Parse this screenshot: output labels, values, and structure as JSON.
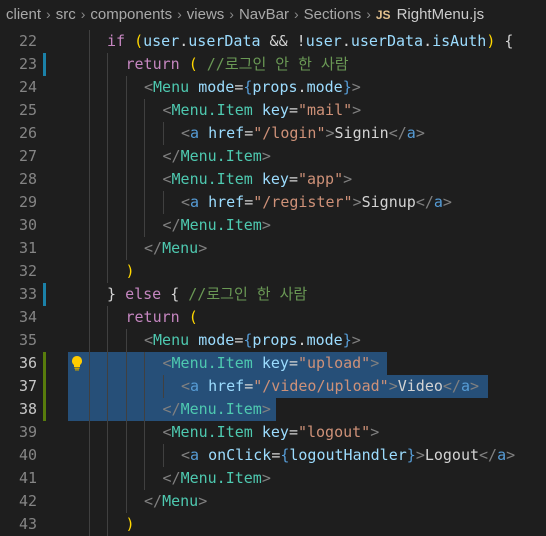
{
  "breadcrumb": {
    "items": [
      "client",
      "src",
      "components",
      "views",
      "NavBar",
      "Sections"
    ],
    "file_icon": "JS",
    "file_name": "RightMenu.js"
  },
  "editor": {
    "first_line_number": 22,
    "selected_lines": [
      36,
      37,
      38
    ],
    "active_lines": [
      36,
      37,
      38
    ],
    "lightbulb_line": 36,
    "change_markers": [
      {
        "line": 23,
        "kind": "modified"
      },
      {
        "line": 33,
        "kind": "modified"
      },
      {
        "line": 36,
        "kind": "added"
      },
      {
        "line": 37,
        "kind": "added"
      },
      {
        "line": 38,
        "kind": "added"
      }
    ],
    "lines": [
      {
        "n": 22,
        "indent": 2,
        "tokens": [
          [
            "kw",
            "if"
          ],
          [
            "p",
            " "
          ],
          [
            "y",
            "("
          ],
          [
            "v",
            "user"
          ],
          [
            "p",
            "."
          ],
          [
            "v",
            "userData"
          ],
          [
            "p",
            " && !"
          ],
          [
            "v",
            "user"
          ],
          [
            "p",
            "."
          ],
          [
            "v",
            "userData"
          ],
          [
            "p",
            "."
          ],
          [
            "v",
            "isAuth"
          ],
          [
            "y",
            ")"
          ],
          [
            "p",
            " {"
          ]
        ]
      },
      {
        "n": 23,
        "indent": 3,
        "tokens": [
          [
            "kw",
            "return"
          ],
          [
            "p",
            " "
          ],
          [
            "y",
            "("
          ],
          [
            "p",
            " "
          ],
          [
            "cm",
            "//로그인 안 한 사람"
          ]
        ]
      },
      {
        "n": 24,
        "indent": 4,
        "tokens": [
          [
            "tg",
            "<"
          ],
          [
            "t",
            "Menu"
          ],
          [
            "p",
            " "
          ],
          [
            "v",
            "mode"
          ],
          [
            "p",
            "="
          ],
          [
            "kb",
            "{"
          ],
          [
            "v",
            "props"
          ],
          [
            "p",
            "."
          ],
          [
            "v",
            "mode"
          ],
          [
            "kb",
            "}"
          ],
          [
            "tg",
            ">"
          ]
        ]
      },
      {
        "n": 25,
        "indent": 5,
        "tokens": [
          [
            "tg",
            "<"
          ],
          [
            "t",
            "Menu.Item"
          ],
          [
            "p",
            " "
          ],
          [
            "v",
            "key"
          ],
          [
            "p",
            "="
          ],
          [
            "s",
            "\"mail\""
          ],
          [
            "tg",
            ">"
          ]
        ]
      },
      {
        "n": 26,
        "indent": 6,
        "tokens": [
          [
            "tg",
            "<"
          ],
          [
            "kb",
            "a"
          ],
          [
            "p",
            " "
          ],
          [
            "v",
            "href"
          ],
          [
            "p",
            "="
          ],
          [
            "s",
            "\"/login\""
          ],
          [
            "tg",
            ">"
          ],
          [
            "p",
            "Signin"
          ],
          [
            "tg",
            "</"
          ],
          [
            "kb",
            "a"
          ],
          [
            "tg",
            ">"
          ]
        ]
      },
      {
        "n": 27,
        "indent": 5,
        "tokens": [
          [
            "tg",
            "</"
          ],
          [
            "t",
            "Menu.Item"
          ],
          [
            "tg",
            ">"
          ]
        ]
      },
      {
        "n": 28,
        "indent": 5,
        "tokens": [
          [
            "tg",
            "<"
          ],
          [
            "t",
            "Menu.Item"
          ],
          [
            "p",
            " "
          ],
          [
            "v",
            "key"
          ],
          [
            "p",
            "="
          ],
          [
            "s",
            "\"app\""
          ],
          [
            "tg",
            ">"
          ]
        ]
      },
      {
        "n": 29,
        "indent": 6,
        "tokens": [
          [
            "tg",
            "<"
          ],
          [
            "kb",
            "a"
          ],
          [
            "p",
            " "
          ],
          [
            "v",
            "href"
          ],
          [
            "p",
            "="
          ],
          [
            "s",
            "\"/register\""
          ],
          [
            "tg",
            ">"
          ],
          [
            "p",
            "Signup"
          ],
          [
            "tg",
            "</"
          ],
          [
            "kb",
            "a"
          ],
          [
            "tg",
            ">"
          ]
        ]
      },
      {
        "n": 30,
        "indent": 5,
        "tokens": [
          [
            "tg",
            "</"
          ],
          [
            "t",
            "Menu.Item"
          ],
          [
            "tg",
            ">"
          ]
        ]
      },
      {
        "n": 31,
        "indent": 4,
        "tokens": [
          [
            "tg",
            "</"
          ],
          [
            "t",
            "Menu"
          ],
          [
            "tg",
            ">"
          ]
        ]
      },
      {
        "n": 32,
        "indent": 3,
        "tokens": [
          [
            "y",
            ")"
          ]
        ]
      },
      {
        "n": 33,
        "indent": 2,
        "tokens": [
          [
            "p",
            "} "
          ],
          [
            "kw",
            "else"
          ],
          [
            "p",
            " { "
          ],
          [
            "cm",
            "//로그인 한 사람"
          ]
        ]
      },
      {
        "n": 34,
        "indent": 3,
        "tokens": [
          [
            "kw",
            "return"
          ],
          [
            "p",
            " "
          ],
          [
            "y",
            "("
          ]
        ]
      },
      {
        "n": 35,
        "indent": 4,
        "tokens": [
          [
            "tg",
            "<"
          ],
          [
            "t",
            "Menu"
          ],
          [
            "p",
            " "
          ],
          [
            "v",
            "mode"
          ],
          [
            "p",
            "="
          ],
          [
            "kb",
            "{"
          ],
          [
            "v",
            "props"
          ],
          [
            "p",
            "."
          ],
          [
            "v",
            "mode"
          ],
          [
            "kb",
            "}"
          ],
          [
            "tg",
            ">"
          ]
        ]
      },
      {
        "n": 36,
        "indent": 5,
        "tokens": [
          [
            "tg",
            "<"
          ],
          [
            "t",
            "Menu.Item"
          ],
          [
            "p",
            " "
          ],
          [
            "v",
            "key"
          ],
          [
            "p",
            "="
          ],
          [
            "s",
            "\"upload\""
          ],
          [
            "tg",
            ">"
          ]
        ]
      },
      {
        "n": 37,
        "indent": 6,
        "tokens": [
          [
            "tg",
            "<"
          ],
          [
            "kb",
            "a"
          ],
          [
            "p",
            " "
          ],
          [
            "v",
            "href"
          ],
          [
            "p",
            "="
          ],
          [
            "s",
            "\"/video/upload\""
          ],
          [
            "tg",
            ">"
          ],
          [
            "p",
            "Video"
          ],
          [
            "tg",
            "</"
          ],
          [
            "kb",
            "a"
          ],
          [
            "tg",
            ">"
          ]
        ]
      },
      {
        "n": 38,
        "indent": 5,
        "tokens": [
          [
            "tg",
            "</"
          ],
          [
            "t",
            "Menu.Item"
          ],
          [
            "tg",
            ">"
          ]
        ]
      },
      {
        "n": 39,
        "indent": 5,
        "tokens": [
          [
            "tg",
            "<"
          ],
          [
            "t",
            "Menu.Item"
          ],
          [
            "p",
            " "
          ],
          [
            "v",
            "key"
          ],
          [
            "p",
            "="
          ],
          [
            "s",
            "\"logout\""
          ],
          [
            "tg",
            ">"
          ]
        ]
      },
      {
        "n": 40,
        "indent": 6,
        "tokens": [
          [
            "tg",
            "<"
          ],
          [
            "kb",
            "a"
          ],
          [
            "p",
            " "
          ],
          [
            "v",
            "onClick"
          ],
          [
            "p",
            "="
          ],
          [
            "kb",
            "{"
          ],
          [
            "v",
            "logoutHandler"
          ],
          [
            "kb",
            "}"
          ],
          [
            "tg",
            ">"
          ],
          [
            "p",
            "Logout"
          ],
          [
            "tg",
            "</"
          ],
          [
            "kb",
            "a"
          ],
          [
            "tg",
            ">"
          ]
        ]
      },
      {
        "n": 41,
        "indent": 5,
        "tokens": [
          [
            "tg",
            "</"
          ],
          [
            "t",
            "Menu.Item"
          ],
          [
            "tg",
            ">"
          ]
        ]
      },
      {
        "n": 42,
        "indent": 4,
        "tokens": [
          [
            "tg",
            "</"
          ],
          [
            "t",
            "Menu"
          ],
          [
            "tg",
            ">"
          ]
        ]
      },
      {
        "n": 43,
        "indent": 3,
        "tokens": [
          [
            "y",
            ")"
          ]
        ]
      }
    ]
  }
}
